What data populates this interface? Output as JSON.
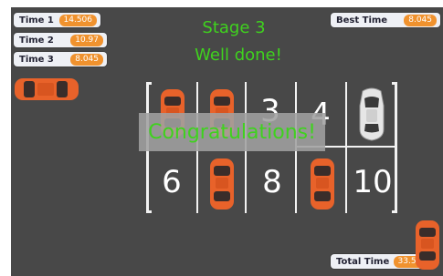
{
  "hud": {
    "time1_label": "Time 1",
    "time1_value": "14.506",
    "time2_label": "Time 2",
    "time2_value": "10.97",
    "time3_label": "Time 3",
    "time3_value": "8.045",
    "best_label": "Best Time",
    "best_value": "8.045",
    "total_label": "Total Time",
    "total_value": "33.521"
  },
  "stage": {
    "title": "Stage 3",
    "subtitle": "Well done!",
    "banner": "Congratulations!"
  },
  "slots": {
    "s3": "3",
    "s4": "4",
    "s6": "6",
    "s8": "8",
    "s10": "10"
  },
  "colors": {
    "background": "#484848",
    "accent_orange": "#f0922e",
    "text_green": "#3fd21e",
    "car_orange": "#e8622a",
    "car_white": "#e6e6e6"
  }
}
